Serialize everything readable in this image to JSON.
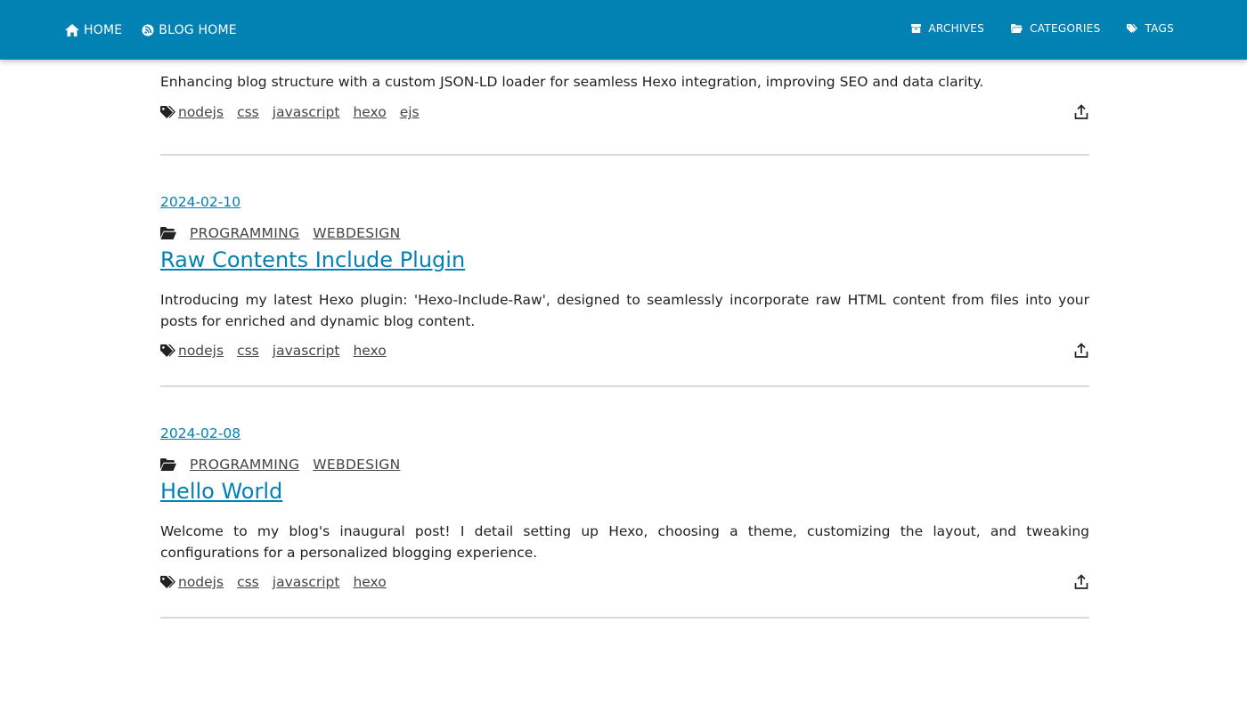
{
  "nav": {
    "left": [
      {
        "label": "HOME",
        "icon": "home-icon"
      },
      {
        "label": "BLOG HOME",
        "icon": "blog-icon"
      }
    ],
    "right": [
      {
        "label": "ARCHIVES",
        "icon": "archive-icon"
      },
      {
        "label": "CATEGORIES",
        "icon": "folder-icon"
      },
      {
        "label": "TAGS",
        "icon": "tags-icon"
      }
    ]
  },
  "colors": {
    "accent": "#0182b3",
    "divider": "#dadada"
  },
  "posts": [
    {
      "excerpt": "Enhancing blog structure with a custom JSON-LD loader for seamless Hexo integration, improving SEO and data clarity.",
      "tags": [
        "nodejs",
        "css",
        "javascript",
        "hexo",
        "ejs"
      ]
    },
    {
      "date": "2024-02-10",
      "categories": [
        "PROGRAMMING",
        "WEBDESIGN"
      ],
      "title": "Raw Contents Include Plugin",
      "excerpt": "Introducing my latest Hexo plugin: 'Hexo-Include-Raw', designed to seamlessly incorporate raw HTML content from files into your posts for enriched and dynamic blog content.",
      "tags": [
        "nodejs",
        "css",
        "javascript",
        "hexo"
      ]
    },
    {
      "date": "2024-02-08",
      "categories": [
        "PROGRAMMING",
        "WEBDESIGN"
      ],
      "title": "Hello World",
      "excerpt": "Welcome to my blog's inaugural post! I detail setting up Hexo, choosing a theme, customizing the layout, and tweaking configurations for a personalized blogging experience.",
      "tags": [
        "nodejs",
        "css",
        "javascript",
        "hexo"
      ]
    }
  ]
}
